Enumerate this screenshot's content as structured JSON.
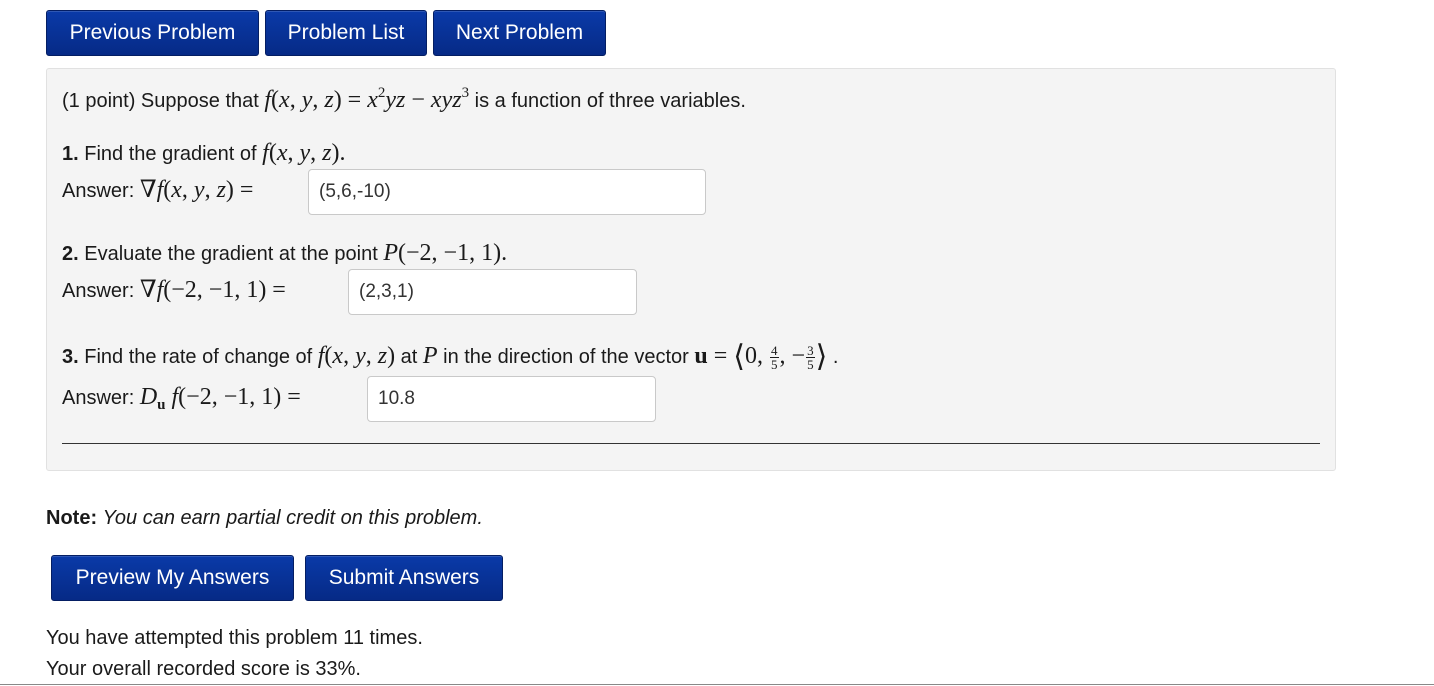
{
  "nav": {
    "previous_label": "Previous Problem",
    "list_label": "Problem List",
    "next_label": "Next Problem"
  },
  "problem": {
    "intro_prefix": "(1 point) Suppose that",
    "intro_suffix": "is a function of three variables.",
    "q1": {
      "number": "1.",
      "text": "Find the gradient of",
      "answer_label": "Answer:",
      "value": "(5,6,-10)"
    },
    "q2": {
      "number": "2.",
      "text": "Evaluate the gradient at the point",
      "answer_label": "Answer:",
      "value": "(2,3,1)"
    },
    "q3": {
      "number": "3.",
      "text_a": "Find the rate of change of",
      "text_b": "at",
      "text_c": "in the direction of the vector",
      "answer_label": "Answer:",
      "value": "10.8"
    }
  },
  "note": {
    "label": "Note:",
    "text": "You can earn partial credit on this problem."
  },
  "actions": {
    "preview_label": "Preview My Answers",
    "submit_label": "Submit Answers"
  },
  "status": {
    "attempts": "You have attempted this problem 11 times.",
    "score": "Your overall recorded score is 33%."
  },
  "colors": {
    "button_bg": "#062a86",
    "panel_bg": "#f4f4f4"
  }
}
